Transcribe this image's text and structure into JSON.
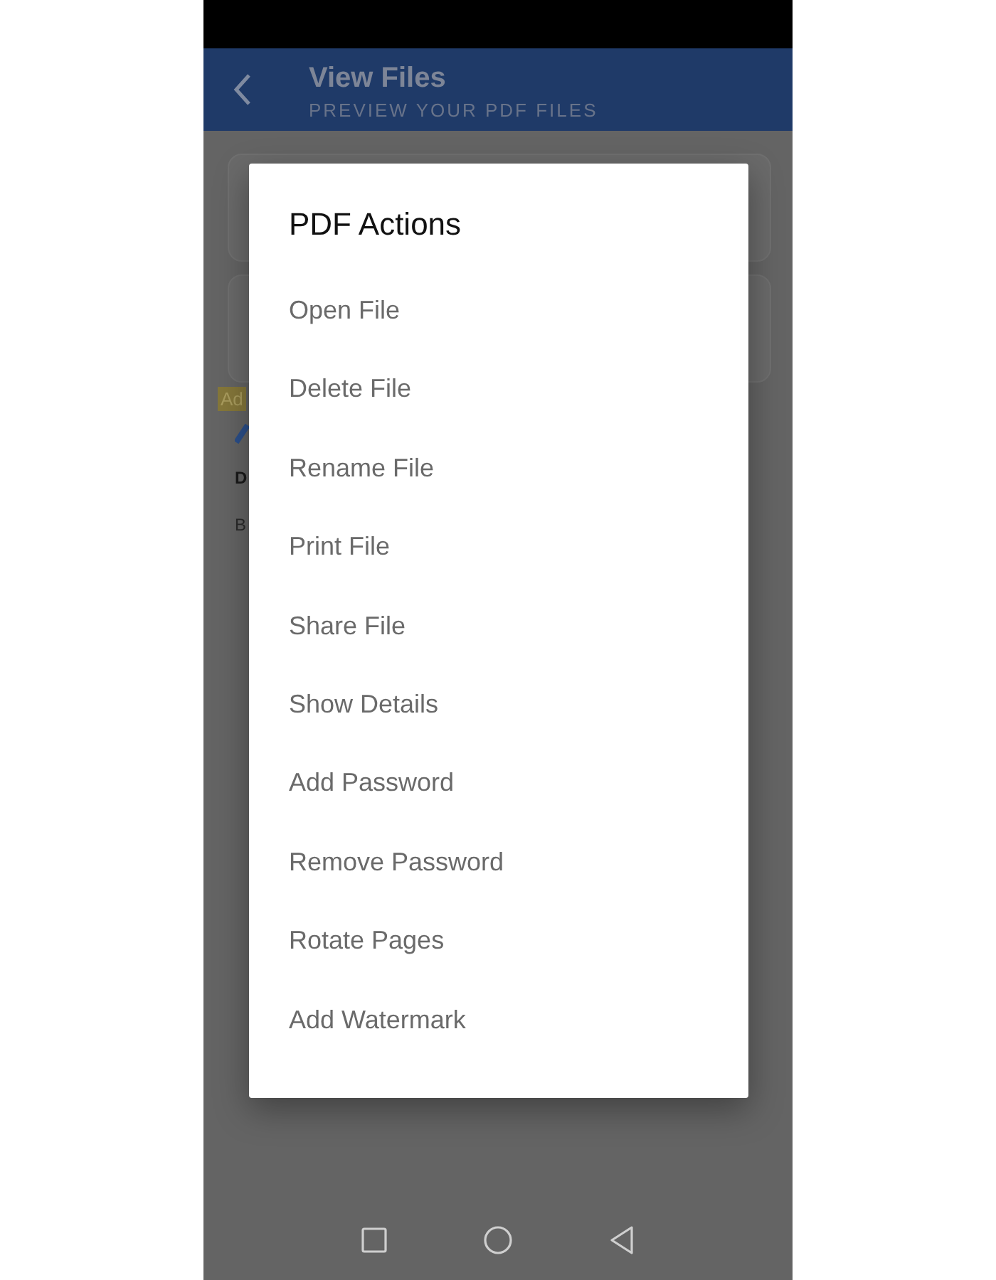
{
  "header": {
    "title": "View Files",
    "subtitle": "PREVIEW YOUR PDF FILES"
  },
  "background": {
    "ad_badge": "Ad",
    "ad_title": "D",
    "ad_text": "B"
  },
  "dialog": {
    "title": "PDF Actions",
    "items": [
      "Open File",
      "Delete File",
      "Rename File",
      "Print File",
      "Share File",
      "Show Details",
      "Add Password",
      "Remove Password",
      "Rotate Pages",
      "Add Watermark"
    ]
  }
}
